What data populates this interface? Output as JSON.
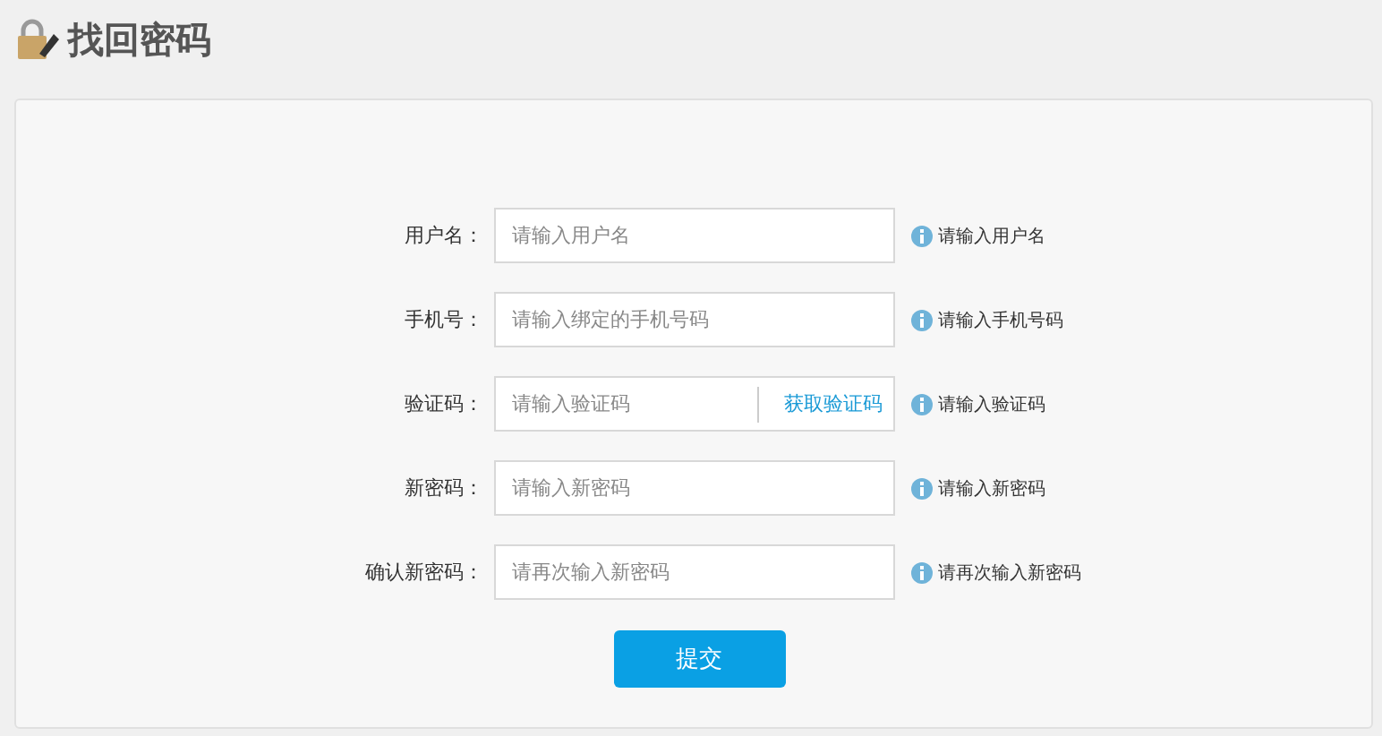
{
  "page": {
    "title": "找回密码"
  },
  "form": {
    "fields": [
      {
        "kind": "text",
        "label": "用户名：",
        "placeholder": "请输入用户名",
        "hint": "请输入用户名"
      },
      {
        "kind": "text",
        "label": "手机号：",
        "placeholder": "请输入绑定的手机号码",
        "hint": "请输入手机号码"
      },
      {
        "kind": "code",
        "label": "验证码：",
        "placeholder": "请输入验证码",
        "action": "获取验证码",
        "hint": "请输入验证码"
      },
      {
        "kind": "text",
        "label": "新密码：",
        "placeholder": "请输入新密码",
        "hint": "请输入新密码"
      },
      {
        "kind": "text",
        "label": "确认新密码：",
        "placeholder": "请再次输入新密码",
        "hint": "请再次输入新密码"
      }
    ],
    "submit": "提交"
  }
}
